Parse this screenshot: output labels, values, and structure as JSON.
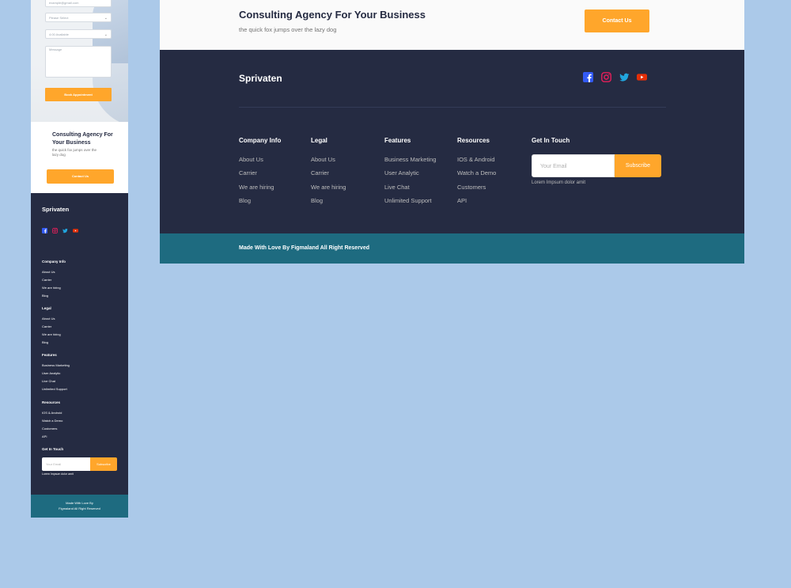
{
  "mobile": {
    "form": {
      "email_value": "example@gmail.com",
      "service_placeholder": "Please Select",
      "doctor_placeholder": "4:00 Available",
      "message_placeholder": "Message",
      "book_label": "Book Appointment"
    },
    "cta": {
      "title": "Consulting Agency For Your Business",
      "subtitle": "the quick fox jumps over the lazy dog",
      "button_label": "Contact Us"
    },
    "footer": {
      "brand": "Sprivaten",
      "columns": [
        {
          "title": "Company Info",
          "links": [
            "About Us",
            "Carrier",
            "We are hiring",
            "Blog"
          ]
        },
        {
          "title": "Legal",
          "links": [
            "About Us",
            "Carrier",
            "We are hiring",
            "Blog"
          ]
        },
        {
          "title": "Features",
          "links": [
            "Business Marketing",
            "User Analytic",
            "Live Chat",
            "Unlimited Support"
          ]
        },
        {
          "title": "Resources",
          "links": [
            "IOS & Android",
            "Watch a Demo",
            "Customers",
            "API"
          ]
        }
      ],
      "get_in_touch_title": "Get In Touch",
      "email_placeholder": "Your Email",
      "subscribe_label": "Subscribe",
      "lorem": "Lorem Impsum dolor amit",
      "bottom_line1": "Made With Love By",
      "bottom_line2": "Figmaland All Right Reserved"
    }
  },
  "desktop": {
    "cta": {
      "title": "Consulting Agency For Your Business",
      "subtitle": "the quick fox jumps over the lazy dog",
      "button_label": "Contact Us"
    },
    "footer": {
      "brand": "Sprivaten",
      "social": [
        "facebook-icon",
        "instagram-icon",
        "twitter-icon",
        "youtube-icon"
      ],
      "columns": [
        {
          "title": "Company Info",
          "links": [
            "About Us",
            "Carrier",
            "We are hiring",
            "Blog"
          ]
        },
        {
          "title": "Legal",
          "links": [
            "About Us",
            "Carrier",
            "We are hiring",
            "Blog"
          ]
        },
        {
          "title": "Features",
          "links": [
            "Business Marketing",
            "User Analytic",
            "Live Chat",
            "Unlimited Support"
          ]
        },
        {
          "title": "Resources",
          "links": [
            "IOS & Android",
            "Watch a Demo",
            "Customers",
            "API"
          ]
        }
      ],
      "get_in_touch_title": "Get In Touch",
      "email_placeholder": "Your Email",
      "subscribe_label": "Subscribe",
      "lorem": "Lorem Impsum dolor amit",
      "bottom_text": "Made With Love By Figmaland All Right Reserved"
    }
  },
  "colors": {
    "background": "#abc9e9",
    "accent": "#ffa62b",
    "footer_dark": "#252b42",
    "bottom_bar": "#1e6b80",
    "facebook": "#335bf5",
    "instagram": "#e51f5a",
    "twitter": "#21a6df",
    "youtube": "#e42f08"
  }
}
